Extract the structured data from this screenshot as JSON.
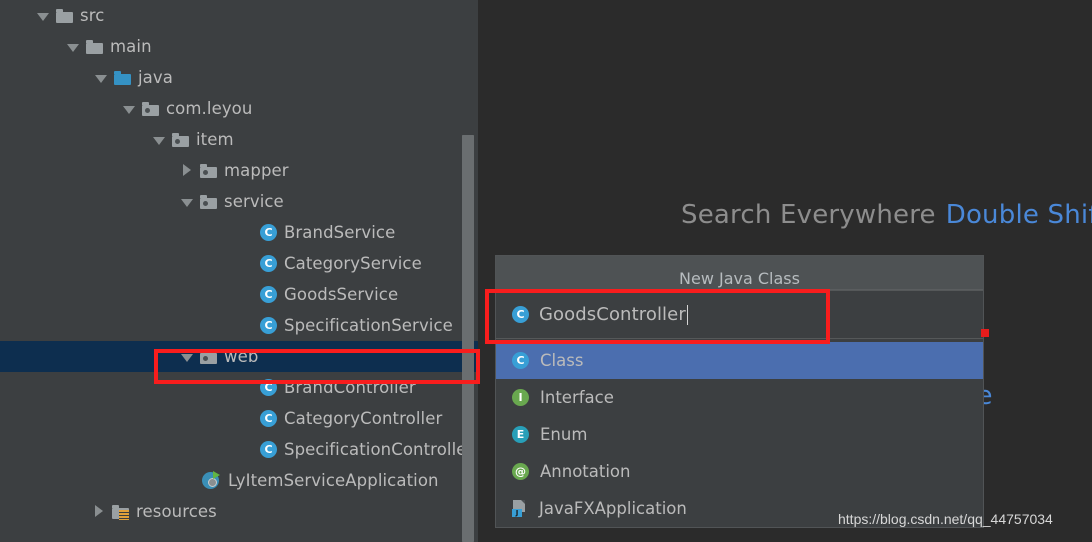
{
  "ide": {
    "editor_background": "#2b2b2b",
    "panel_background": "#3c3f41"
  },
  "project_tree": {
    "items": [
      {
        "label": "src",
        "arrow": "down",
        "icon": "folder-icon",
        "indent": 36,
        "selected": false
      },
      {
        "label": "main",
        "arrow": "down",
        "icon": "folder-icon",
        "indent": 66,
        "selected": false
      },
      {
        "label": "java",
        "arrow": "down",
        "icon": "source-folder-icon",
        "indent": 94,
        "selected": false
      },
      {
        "label": "com.leyou",
        "arrow": "down",
        "icon": "package-icon",
        "indent": 122,
        "selected": false
      },
      {
        "label": "item",
        "arrow": "down",
        "icon": "package-icon",
        "indent": 152,
        "selected": false
      },
      {
        "label": "mapper",
        "arrow": "right",
        "icon": "package-icon",
        "indent": 180,
        "selected": false
      },
      {
        "label": "service",
        "arrow": "down",
        "icon": "package-icon",
        "indent": 180,
        "selected": false
      },
      {
        "label": "BrandService",
        "arrow": "none",
        "icon": "class-icon",
        "indent": 240,
        "selected": false
      },
      {
        "label": "CategoryService",
        "arrow": "none",
        "icon": "class-icon",
        "indent": 240,
        "selected": false
      },
      {
        "label": "GoodsService",
        "arrow": "none",
        "icon": "class-icon",
        "indent": 240,
        "selected": false
      },
      {
        "label": "SpecificationService",
        "arrow": "none",
        "icon": "class-icon",
        "indent": 240,
        "selected": false
      },
      {
        "label": "web",
        "arrow": "down",
        "icon": "package-icon",
        "indent": 180,
        "selected": true
      },
      {
        "label": "BrandController",
        "arrow": "none",
        "icon": "class-icon",
        "indent": 240,
        "selected": false
      },
      {
        "label": "CategoryController",
        "arrow": "none",
        "icon": "class-icon",
        "indent": 240,
        "selected": false
      },
      {
        "label": "SpecificationController",
        "arrow": "none",
        "icon": "class-icon",
        "indent": 240,
        "selected": false
      },
      {
        "label": "LyItemServiceApplication",
        "arrow": "none",
        "icon": "spring-boot-run-icon",
        "indent": 182,
        "selected": false
      },
      {
        "label": "resources",
        "arrow": "right",
        "icon": "resources-folder-icon",
        "indent": 92,
        "selected": false
      }
    ]
  },
  "hints": {
    "search_everywhere_label": "Search Everywhere",
    "search_everywhere_shortcut": "Double Shift",
    "secondary_hint_fragment": "ne"
  },
  "new_class_popup": {
    "title": "New Java Class",
    "name_value": "GoodsController",
    "name_icon": "class-icon",
    "kinds": [
      {
        "label": "Class",
        "icon": "class-icon",
        "selected": true
      },
      {
        "label": "Interface",
        "icon": "interface-icon",
        "selected": false
      },
      {
        "label": "Enum",
        "icon": "enum-icon",
        "selected": false
      },
      {
        "label": "Annotation",
        "icon": "annotation-icon",
        "selected": false
      },
      {
        "label": "JavaFXApplication",
        "icon": "javafx-icon",
        "selected": false
      }
    ]
  },
  "annotations": {
    "highlight_color": "#f81d1d",
    "boxes": [
      "web-folder-row",
      "class-name-input"
    ],
    "marker_dot": "#e81c1c"
  },
  "watermark": {
    "text": "https://blog.csdn.net/qq_44757034"
  }
}
